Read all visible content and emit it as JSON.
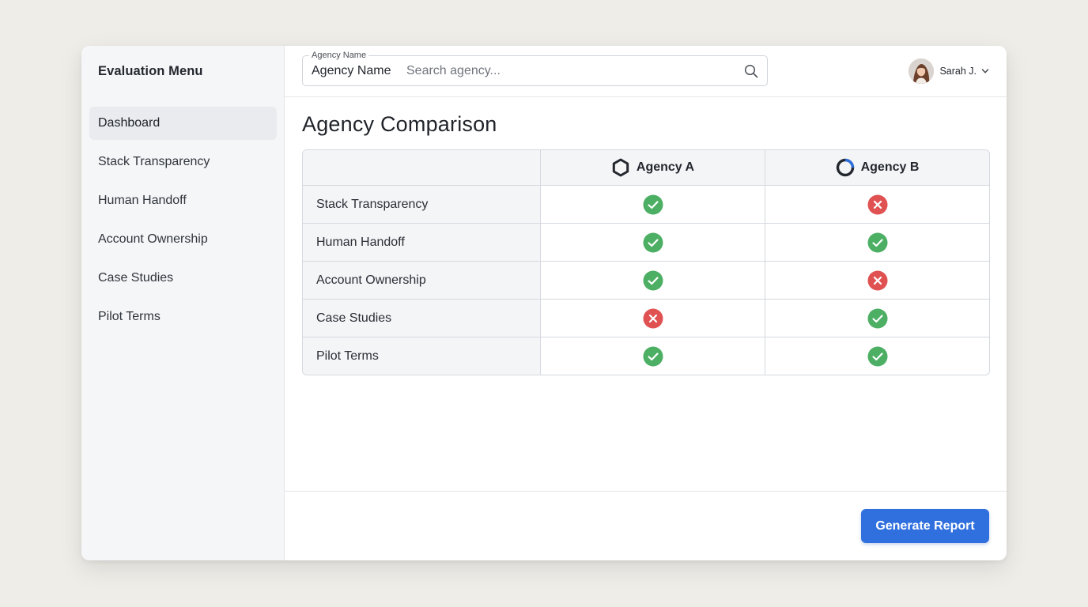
{
  "sidebar": {
    "title": "Evaluation Menu",
    "items": [
      {
        "label": "Dashboard",
        "active": true
      },
      {
        "label": "Stack Transparency",
        "active": false
      },
      {
        "label": "Human Handoff",
        "active": false
      },
      {
        "label": "Account Ownership",
        "active": false
      },
      {
        "label": "Case Studies",
        "active": false
      },
      {
        "label": "Pilot Terms",
        "active": false
      }
    ]
  },
  "search": {
    "legend": "Agency Name",
    "label": "Agency Name",
    "placeholder": "Search agency...",
    "value": "",
    "icon": "search-icon"
  },
  "user": {
    "name": "Sarah J.",
    "avatar_icon": "avatar",
    "menu_icon": "chevron-down-icon"
  },
  "page": {
    "title": "Agency Comparison"
  },
  "comparison": {
    "agencies": [
      {
        "name": "Agency A",
        "logo_icon": "hexagon-logo-icon"
      },
      {
        "name": "Agency B",
        "logo_icon": "ring-logo-icon"
      }
    ],
    "rows": [
      {
        "criterion": "Stack Transparency",
        "agency_a": "pass",
        "agency_b": "fail"
      },
      {
        "criterion": "Human Handoff",
        "agency_a": "pass",
        "agency_b": "pass"
      },
      {
        "criterion": "Account Ownership",
        "agency_a": "pass",
        "agency_b": "fail"
      },
      {
        "criterion": "Case Studies",
        "agency_a": "fail",
        "agency_b": "pass"
      },
      {
        "criterion": "Pilot Terms",
        "agency_a": "pass",
        "agency_b": "pass"
      }
    ]
  },
  "footer": {
    "generate_label": "Generate Report"
  },
  "colors": {
    "accent": "#2f6fde",
    "pass": "#4caf63",
    "fail": "#e05252",
    "background": "#efede8"
  }
}
